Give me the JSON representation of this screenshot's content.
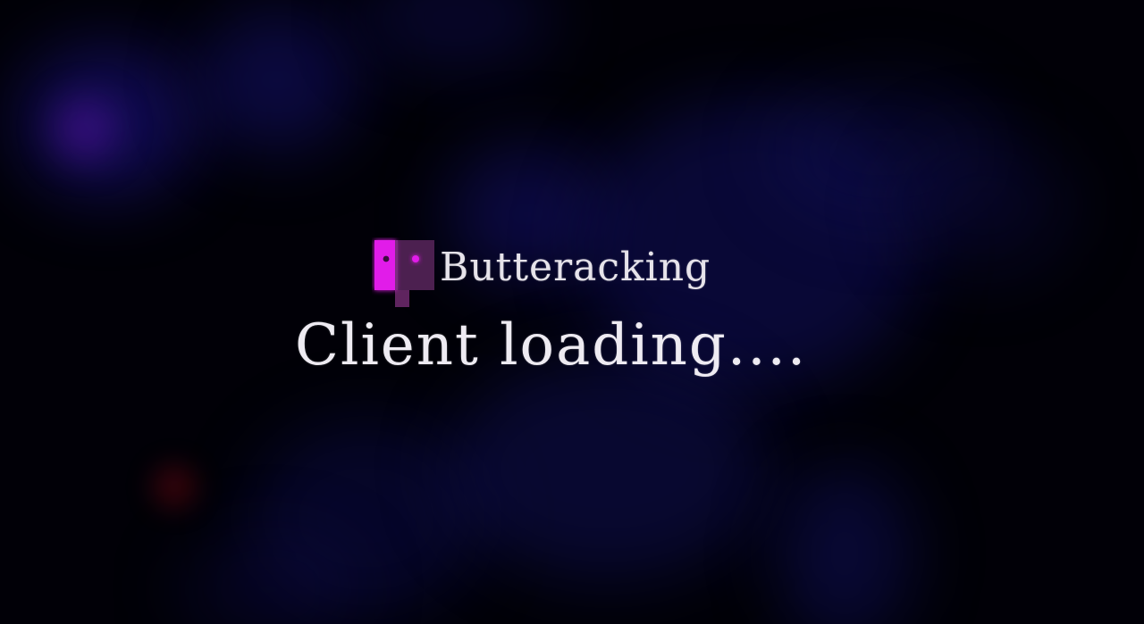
{
  "app": {
    "name": "Butteracking",
    "logo_icon": "butteracking-logo-icon"
  },
  "loader": {
    "status_text": "Client loading...."
  },
  "colors": {
    "background": "#010007",
    "glow_blue": "#1a1680",
    "logo_magenta": "#e11ce9",
    "logo_shadow": "#7a2e7f",
    "text": "#e9e6ee"
  }
}
